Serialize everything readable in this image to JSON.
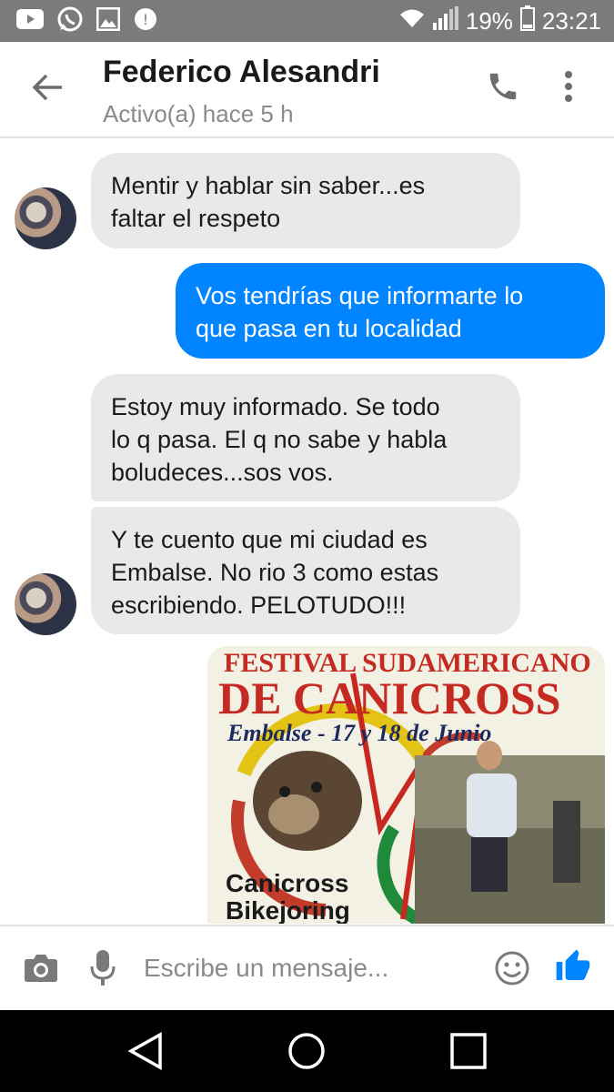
{
  "status_bar": {
    "battery_percent": "19%",
    "time": "23:21",
    "icons": [
      "youtube-icon",
      "whatsapp-icon",
      "gallery-icon",
      "messenger-icon",
      "wifi-icon",
      "signal-icon",
      "battery-icon"
    ]
  },
  "header": {
    "contact_name": "Federico Alesandri",
    "status": "Activo(a) hace 5 h",
    "icons": [
      "back-arrow-icon",
      "phone-icon",
      "more-vert-icon"
    ]
  },
  "messages": [
    {
      "sender": "contact",
      "lines": [
        "Mentir y hablar sin saber...es",
        "faltar el respeto"
      ]
    },
    {
      "sender": "me",
      "lines": [
        "Vos tendrías que informarte lo",
        "que pasa en tu localidad"
      ]
    },
    {
      "sender": "contact",
      "lines": [
        "Estoy muy informado. Se todo",
        "lo q pasa. El q no sabe y habla",
        "boludeces...sos vos."
      ]
    },
    {
      "sender": "contact",
      "lines": [
        "Y te cuento que mi ciudad es",
        "Embalse. No rio 3 como estas",
        "escribiendo. PELOTUDO!!!"
      ]
    }
  ],
  "image_message": {
    "sender": "me",
    "poster_lines": [
      "FESTIVAL SUDAMERICANO",
      "DE CANICROSS",
      "Embalse - 17 y 18 de Junio",
      "Canicross",
      "Bikejoring"
    ]
  },
  "composer": {
    "placeholder": "Escribe un mensaje...",
    "icons": [
      "camera-icon",
      "microphone-icon",
      "emoji-icon",
      "thumbs-up-icon"
    ]
  },
  "nav_bar": {
    "icons": [
      "back-triangle-icon",
      "home-circle-icon",
      "recents-square-icon"
    ]
  },
  "colors": {
    "status_bar_bg": "#7b7b7b",
    "outgoing_bubble": "#0084ff",
    "incoming_bubble": "#e9e9eb",
    "accent": "#0084ff"
  }
}
